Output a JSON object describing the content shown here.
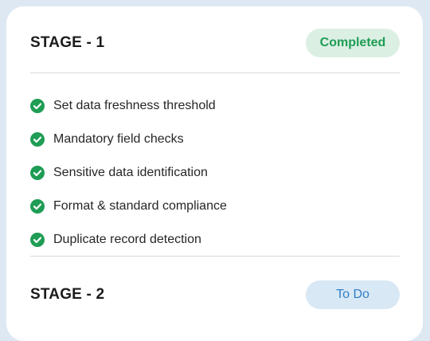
{
  "stages": [
    {
      "title": "STAGE - 1",
      "status": "Completed",
      "items": [
        "Set data freshness threshold",
        "Mandatory field checks",
        "Sensitive data identification",
        "Format & standard compliance",
        "Duplicate record detection"
      ]
    },
    {
      "title": "STAGE - 2",
      "status": "To Do"
    }
  ],
  "icons": {
    "item_icon": "check-circle-icon"
  },
  "colors": {
    "background": "#dde8f3",
    "card": "#ffffff",
    "completed_bg": "#dcefe3",
    "completed_text": "#1f9d55",
    "todo_bg": "#d9e8f5",
    "todo_text": "#2f7fc7",
    "check": "#1f9d55"
  }
}
